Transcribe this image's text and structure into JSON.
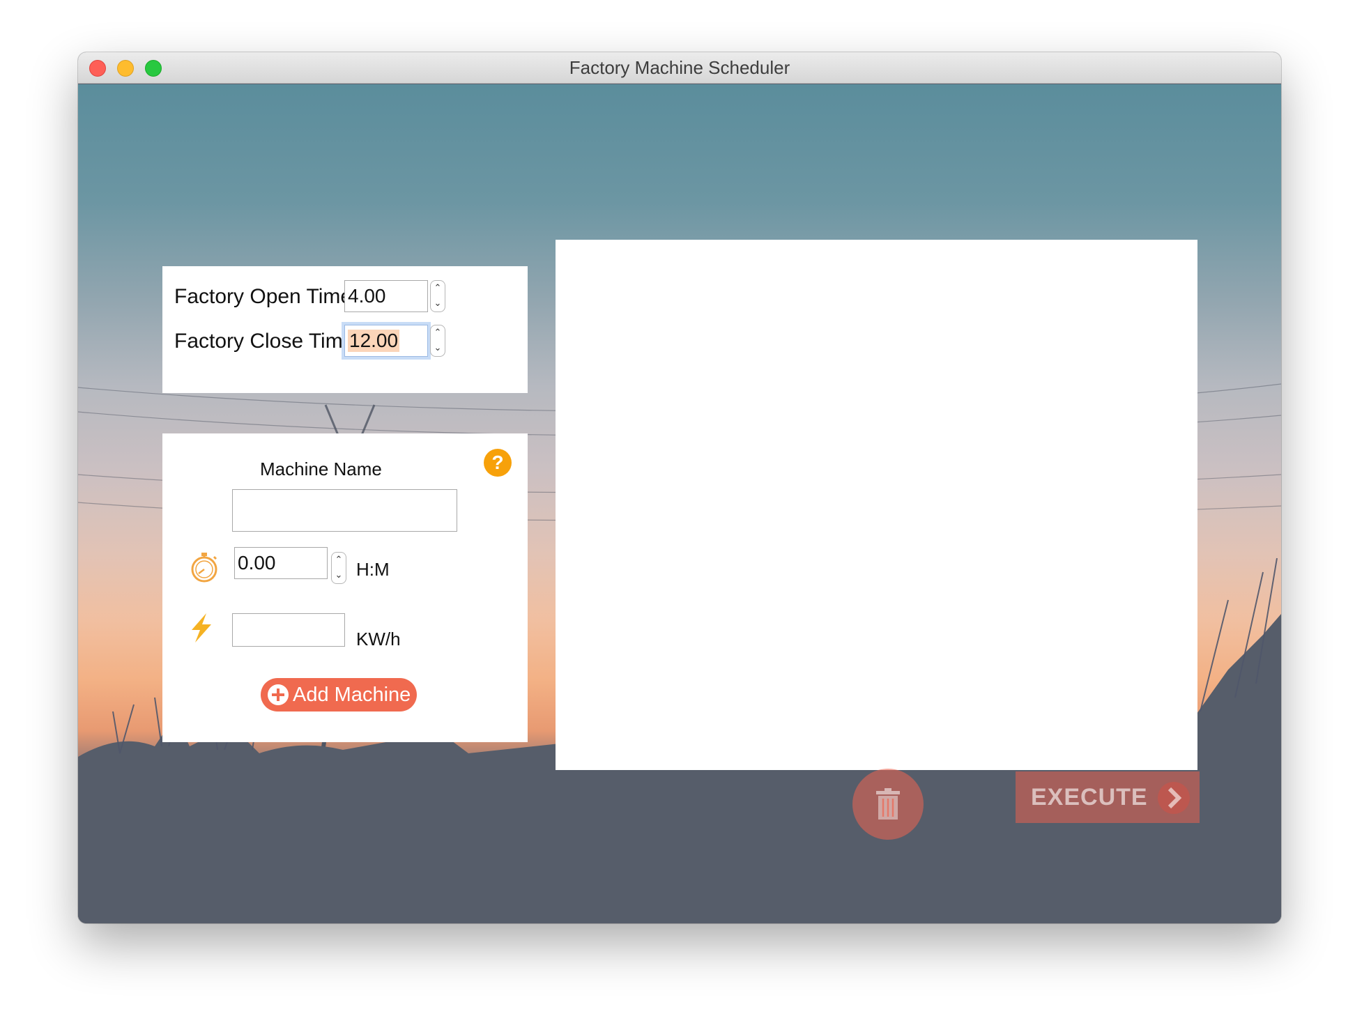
{
  "window": {
    "title": "Factory Machine Scheduler"
  },
  "times": {
    "open_label": "Factory Open Time :",
    "open_value": "4.00",
    "close_label": "Factory Close Time :",
    "close_value": "12.00"
  },
  "machine": {
    "name_label": "Machine Name",
    "name_value": "",
    "help_glyph": "?",
    "duration_value": "0.00",
    "duration_unit": "H:M",
    "power_value": "",
    "power_unit": "KW/h",
    "add_button": "Add Machine"
  },
  "actions": {
    "execute_label": "EXECUTE"
  },
  "icons": {
    "stopwatch": "stopwatch-icon",
    "power": "lightning-icon",
    "help": "help-icon",
    "add": "plus-circle-icon",
    "delete": "trash-icon",
    "execute": "chevron-right-icon"
  },
  "colors": {
    "accent": "#f06a4f",
    "help": "#f7a10a",
    "stopwatch": "#f2a541",
    "lightning": "#f5b223",
    "selection": "#fbd5b9"
  }
}
